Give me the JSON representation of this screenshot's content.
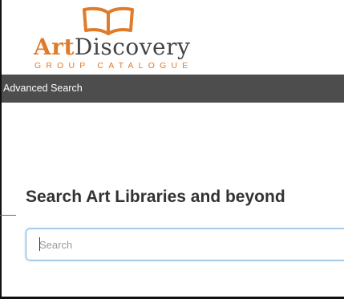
{
  "brand": {
    "name_part1": "Art",
    "name_part2": "Discovery",
    "tagline": "GROUP CATALOGUE",
    "colors": {
      "accent": "#e07b2a",
      "text": "#444444"
    },
    "logo_icon": "open-book-icon"
  },
  "nav": {
    "items": [
      {
        "label": "Advanced Search"
      }
    ],
    "background": "#4d4d4d"
  },
  "main": {
    "headline": "Search Art Libraries and beyond",
    "search": {
      "placeholder": "Search",
      "value": ""
    }
  }
}
